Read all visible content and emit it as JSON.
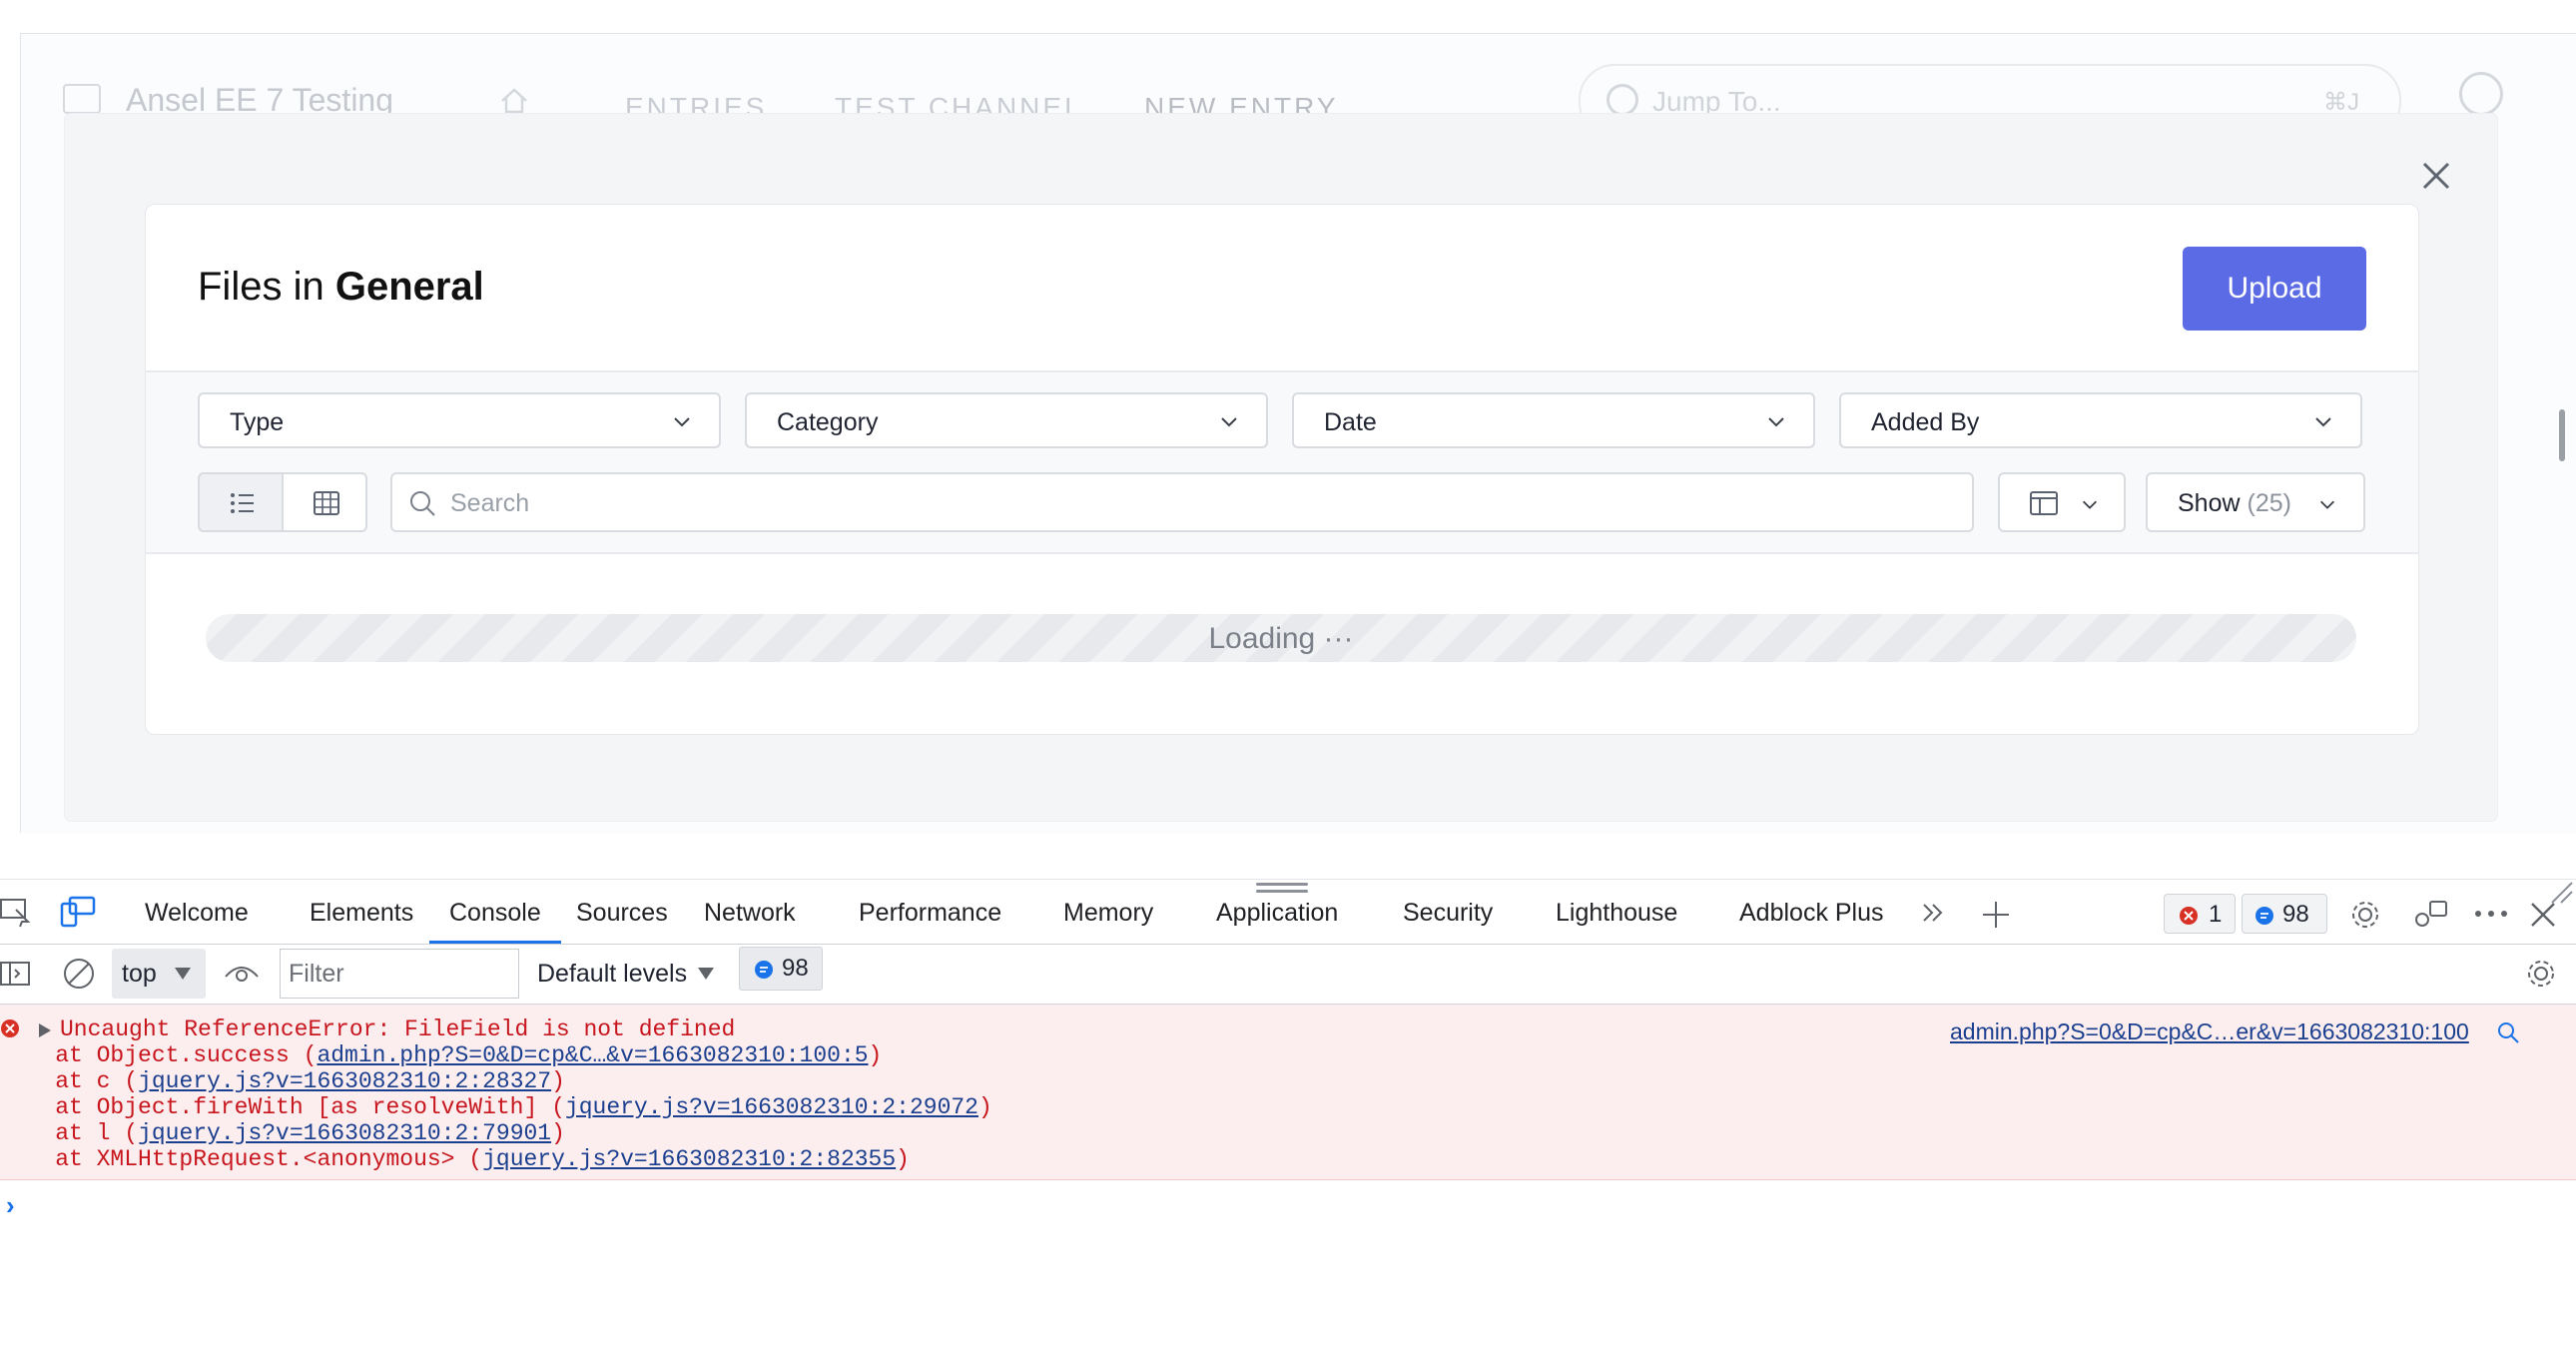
{
  "app": {
    "site_name": "Ansel EE 7 Testing",
    "nav": [
      "ENTRIES",
      "TEST CHANNEL",
      "NEW ENTRY"
    ],
    "jump_placeholder": "Jump To...",
    "jump_shortcut": "⌘J"
  },
  "modal": {
    "title_prefix": "Files in",
    "title_bold": "General",
    "upload_label": "Upload",
    "filters": [
      {
        "label": "Type"
      },
      {
        "label": "Category"
      },
      {
        "label": "Date"
      },
      {
        "label": "Added By"
      }
    ],
    "search_placeholder": "Search",
    "show_label": "Show",
    "show_count": "(25)",
    "loading_text": "Loading ···"
  },
  "devtools": {
    "tabs": [
      "Welcome",
      "Elements",
      "Console",
      "Sources",
      "Network",
      "Performance",
      "Memory",
      "Application",
      "Security",
      "Lighthouse",
      "Adblock Plus"
    ],
    "active_tab": "Console",
    "error_count": "1",
    "message_count": "98",
    "console": {
      "context": "top",
      "filter_placeholder": "Filter",
      "levels": "Default levels",
      "issues_count": "98"
    },
    "error": {
      "message": "Uncaught ReferenceError: FileField is not defined",
      "source": "admin.php?S=0&D=cp&C…er&v=1663082310:100",
      "stack": [
        {
          "prefix": "    at Object.success (",
          "link": "admin.php?S=0&D=cp&C…&v=1663082310:100:5",
          "suffix": ")"
        },
        {
          "prefix": "    at c (",
          "link": "jquery.js?v=1663082310:2:28327",
          "suffix": ")"
        },
        {
          "prefix": "    at Object.fireWith [as resolveWith] (",
          "link": "jquery.js?v=1663082310:2:29072",
          "suffix": ")"
        },
        {
          "prefix": "    at l (",
          "link": "jquery.js?v=1663082310:2:79901",
          "suffix": ")"
        },
        {
          "prefix": "    at XMLHttpRequest.<anonymous> (",
          "link": "jquery.js?v=1663082310:2:82355",
          "suffix": ")"
        }
      ]
    },
    "prompt_symbol": "›"
  },
  "icons": {
    "close": "close-icon",
    "chevron": "chevron-down-icon",
    "list": "list-view-icon",
    "grid": "grid-view-icon",
    "search": "search-icon",
    "columns": "columns-icon",
    "gear": "gear-icon"
  },
  "colors": {
    "accent": "#5b6ae5",
    "devtools_active": "#1a73e8",
    "error_text": "#c7161d",
    "error_bg": "#fcedee"
  }
}
